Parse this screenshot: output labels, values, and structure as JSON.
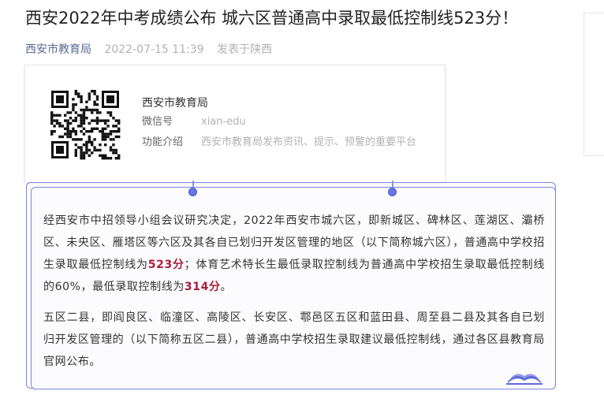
{
  "article": {
    "title": "西安2022年中考成绩公布 城六区普通高中录取最低控制线523分！",
    "account": "西安市教育局",
    "date": "2022-07-15 11:39",
    "location": "发表于陕西"
  },
  "profile_card": {
    "name": "西安市教育局",
    "wechat_label": "微信号",
    "wechat_id": "xian-edu",
    "intro_label": "功能介绍",
    "intro": "西安市教育局发布资讯、提示、预警的重要平台"
  },
  "content": {
    "p1_a": "经西安市中招领导小组会议研究决定，2022年西安市城六区，即新城区、碑林区、莲湖区、灞桥区、未央区、雁塔区等六区及其各自已划归开发区管理的地区（以下简称城六区），普通高中学校招生录取最低控制线为",
    "p1_score1": "523分",
    "p1_b": "；体育艺术特长生最低录取控制线为普通高中学校招生录取最低控制线的60%，最低录取控制线为",
    "p1_score2": "314分",
    "p1_c": "。",
    "p2": "五区二县，即阎良区、临潼区、高陵区、长安区、鄠邑区五区和蓝田县、周至县二县及其各自已划归开发区管理的（以下简称五区二县），普通高中学校招生录取建议最低控制线，通过各区县教育局官网公布。"
  },
  "colors": {
    "frame": "#7c84e0",
    "highlight": "#a91c3c",
    "account_link": "#576b95"
  },
  "icons": [
    "qr-code-icon",
    "book-icon"
  ]
}
